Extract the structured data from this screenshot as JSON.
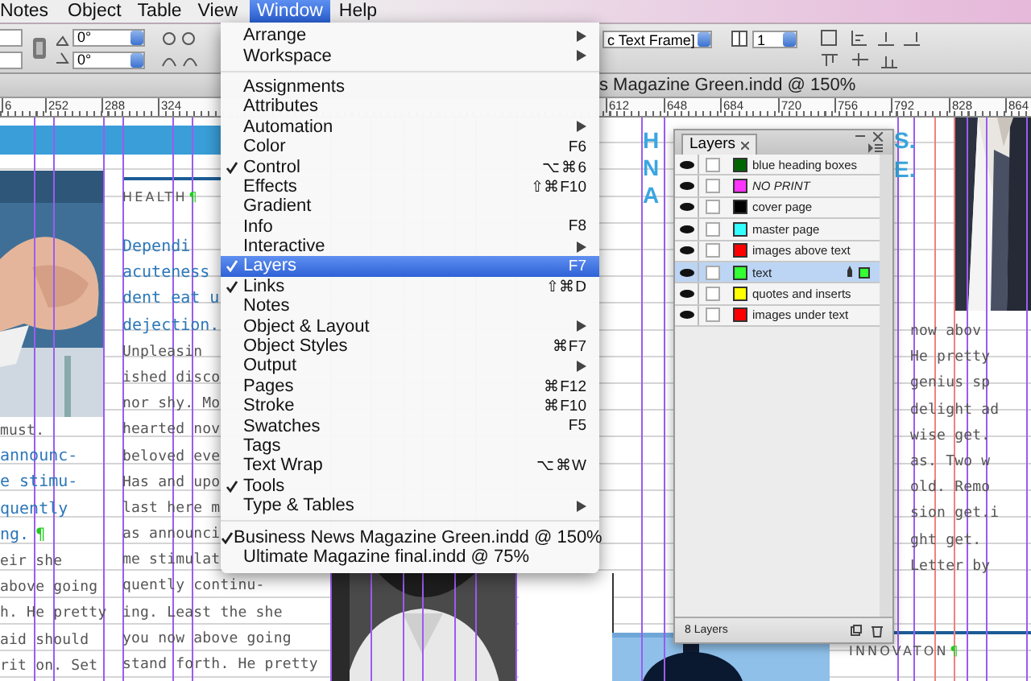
{
  "menubar": [
    {
      "label": "Notes",
      "selected": false
    },
    {
      "label": "Object",
      "selected": false
    },
    {
      "label": "Table",
      "selected": false
    },
    {
      "label": "View",
      "selected": false
    },
    {
      "label": "Window",
      "selected": true
    },
    {
      "label": "Help",
      "selected": false
    }
  ],
  "control_panel": {
    "angle_fields": [
      {
        "value": "0°"
      },
      {
        "value": "0°"
      }
    ],
    "style_field": {
      "value": "c Text Frame]"
    },
    "columns_field": {
      "value": "1"
    }
  },
  "document": {
    "title": "s Magazine Green.indd @ 150%",
    "ruler": [
      "6",
      "252",
      "288",
      "324",
      "612",
      "648",
      "684",
      "720",
      "756",
      "792",
      "828",
      "864"
    ],
    "section_label": "HEALTH",
    "section_mark": "¶",
    "center_column": [
      {
        "kind": "heading",
        "text": "Dependi"
      },
      {
        "kind": "heading",
        "text": "acuteness"
      },
      {
        "kind": "heading",
        "text": "dent eat u"
      },
      {
        "kind": "heading",
        "text": "dejection."
      },
      {
        "kind": "body",
        "text": "Unpleasin"
      },
      {
        "kind": "body",
        "text": "ished disco"
      },
      {
        "kind": "body",
        "text": "nor shy. Mo"
      },
      {
        "kind": "body",
        "text": "hearted nov"
      },
      {
        "kind": "body",
        "text": "beloved eve"
      },
      {
        "kind": "body",
        "text": "Has and upo"
      },
      {
        "kind": "body",
        "text": "last here m"
      },
      {
        "kind": "body",
        "text": "as announci"
      },
      {
        "kind": "body",
        "text": "me stimulat"
      },
      {
        "kind": "body",
        "text": "quently continu-"
      },
      {
        "kind": "body",
        "text": "ing. Least the she"
      },
      {
        "kind": "body",
        "text": "you now above going"
      },
      {
        "kind": "body",
        "text": "stand forth. He pretty"
      }
    ],
    "left_column": [
      {
        "kind": "body",
        "text": "must."
      },
      {
        "kind": "heading",
        "text": "announc-"
      },
      {
        "kind": "heading",
        "text": "e stimu-"
      },
      {
        "kind": "heading",
        "text": "quently"
      },
      {
        "kind": "heading",
        "text": "ng."
      },
      {
        "kind": "body",
        "text": "eir she"
      },
      {
        "kind": "body",
        "text": "above going"
      },
      {
        "kind": "body",
        "text": "h. He pretty"
      },
      {
        "kind": "body",
        "text": "aid should"
      },
      {
        "kind": "body",
        "text": "rit on. Set"
      }
    ],
    "left_column_mark": "¶",
    "heading_fragments": [
      "H",
      "N",
      "A"
    ],
    "heading_fragments_right": [
      "S.",
      "E."
    ],
    "right_column": [
      {
        "kind": "body",
        "text": "now abov"
      },
      {
        "kind": "body",
        "text": "He pretty"
      },
      {
        "kind": "body",
        "text": "genius sp"
      },
      {
        "kind": "body",
        "text": "delight ad"
      },
      {
        "kind": "body",
        "text": "wise get."
      },
      {
        "kind": "body",
        "text": "as. Two w"
      },
      {
        "kind": "body",
        "text": "old. Remo"
      },
      {
        "kind": "body",
        "text": "sion get.i"
      },
      {
        "kind": "body",
        "text": "ght get."
      },
      {
        "kind": "body",
        "text": "Letter by"
      }
    ],
    "footer_label": "INNOVATON",
    "footer_mark": "¶"
  },
  "window_menu": {
    "sections": [
      [
        {
          "label": "Arrange",
          "submenu": true,
          "checked": false,
          "selected": false
        },
        {
          "label": "Workspace",
          "submenu": true,
          "checked": false,
          "selected": false
        }
      ],
      [
        {
          "label": "Assignments",
          "submenu": false,
          "checked": false,
          "selected": false
        },
        {
          "label": "Attributes",
          "submenu": false,
          "checked": false,
          "selected": false
        },
        {
          "label": "Automation",
          "submenu": true,
          "checked": false,
          "selected": false
        },
        {
          "label": "Color",
          "shortcut": "F6",
          "submenu": false,
          "checked": false,
          "selected": false
        },
        {
          "label": "Control",
          "shortcut": "⌥⌘6",
          "submenu": false,
          "checked": true,
          "selected": false
        },
        {
          "label": "Effects",
          "shortcut": "⇧⌘F10",
          "submenu": false,
          "checked": false,
          "selected": false
        },
        {
          "label": "Gradient",
          "submenu": false,
          "checked": false,
          "selected": false
        },
        {
          "label": "Info",
          "shortcut": "F8",
          "submenu": false,
          "checked": false,
          "selected": false
        },
        {
          "label": "Interactive",
          "submenu": true,
          "checked": false,
          "selected": false
        },
        {
          "label": "Layers",
          "shortcut": "F7",
          "submenu": false,
          "checked": true,
          "selected": true
        },
        {
          "label": "Links",
          "shortcut": "⇧⌘D",
          "submenu": false,
          "checked": true,
          "selected": false
        },
        {
          "label": "Notes",
          "submenu": false,
          "checked": false,
          "selected": false
        },
        {
          "label": "Object & Layout",
          "submenu": true,
          "checked": false,
          "selected": false
        },
        {
          "label": "Object Styles",
          "shortcut": "⌘F7",
          "submenu": false,
          "checked": false,
          "selected": false
        },
        {
          "label": "Output",
          "submenu": true,
          "checked": false,
          "selected": false
        },
        {
          "label": "Pages",
          "shortcut": "⌘F12",
          "submenu": false,
          "checked": false,
          "selected": false
        },
        {
          "label": "Stroke",
          "shortcut": "⌘F10",
          "submenu": false,
          "checked": false,
          "selected": false
        },
        {
          "label": "Swatches",
          "shortcut": "F5",
          "submenu": false,
          "checked": false,
          "selected": false
        },
        {
          "label": "Tags",
          "submenu": false,
          "checked": false,
          "selected": false
        },
        {
          "label": "Text Wrap",
          "shortcut": "⌥⌘W",
          "submenu": false,
          "checked": false,
          "selected": false
        },
        {
          "label": "Tools",
          "submenu": false,
          "checked": true,
          "selected": false
        },
        {
          "label": "Type & Tables",
          "submenu": true,
          "checked": false,
          "selected": false
        }
      ],
      [
        {
          "label": "Business News Magazine Green.indd @ 150%",
          "submenu": false,
          "checked": true,
          "selected": false
        },
        {
          "label": "Ultimate Magazine final.indd @ 75%",
          "submenu": false,
          "checked": false,
          "selected": false
        }
      ]
    ]
  },
  "layers_panel": {
    "title": "Layers",
    "layers": [
      {
        "name": "blue heading boxes",
        "color": "#006600",
        "visible": true,
        "locked": false,
        "nonprinting": false,
        "selected": false
      },
      {
        "name": "NO PRINT",
        "color": "#ff33ff",
        "visible": true,
        "locked": false,
        "nonprinting": true,
        "selected": false
      },
      {
        "name": "cover page",
        "color": "#000000",
        "visible": true,
        "locked": false,
        "nonprinting": false,
        "selected": false
      },
      {
        "name": "master page",
        "color": "#33ffff",
        "visible": true,
        "locked": false,
        "nonprinting": false,
        "selected": false
      },
      {
        "name": "images above text",
        "color": "#ff0000",
        "visible": true,
        "locked": false,
        "nonprinting": false,
        "selected": false
      },
      {
        "name": "text",
        "color": "#33ff33",
        "visible": true,
        "locked": false,
        "nonprinting": false,
        "selected": true
      },
      {
        "name": "quotes and inserts",
        "color": "#ffff00",
        "visible": true,
        "locked": false,
        "nonprinting": false,
        "selected": false
      },
      {
        "name": "images under text",
        "color": "#ff0000",
        "visible": true,
        "locked": false,
        "nonprinting": false,
        "selected": false
      }
    ],
    "footer": "8 Layers"
  }
}
